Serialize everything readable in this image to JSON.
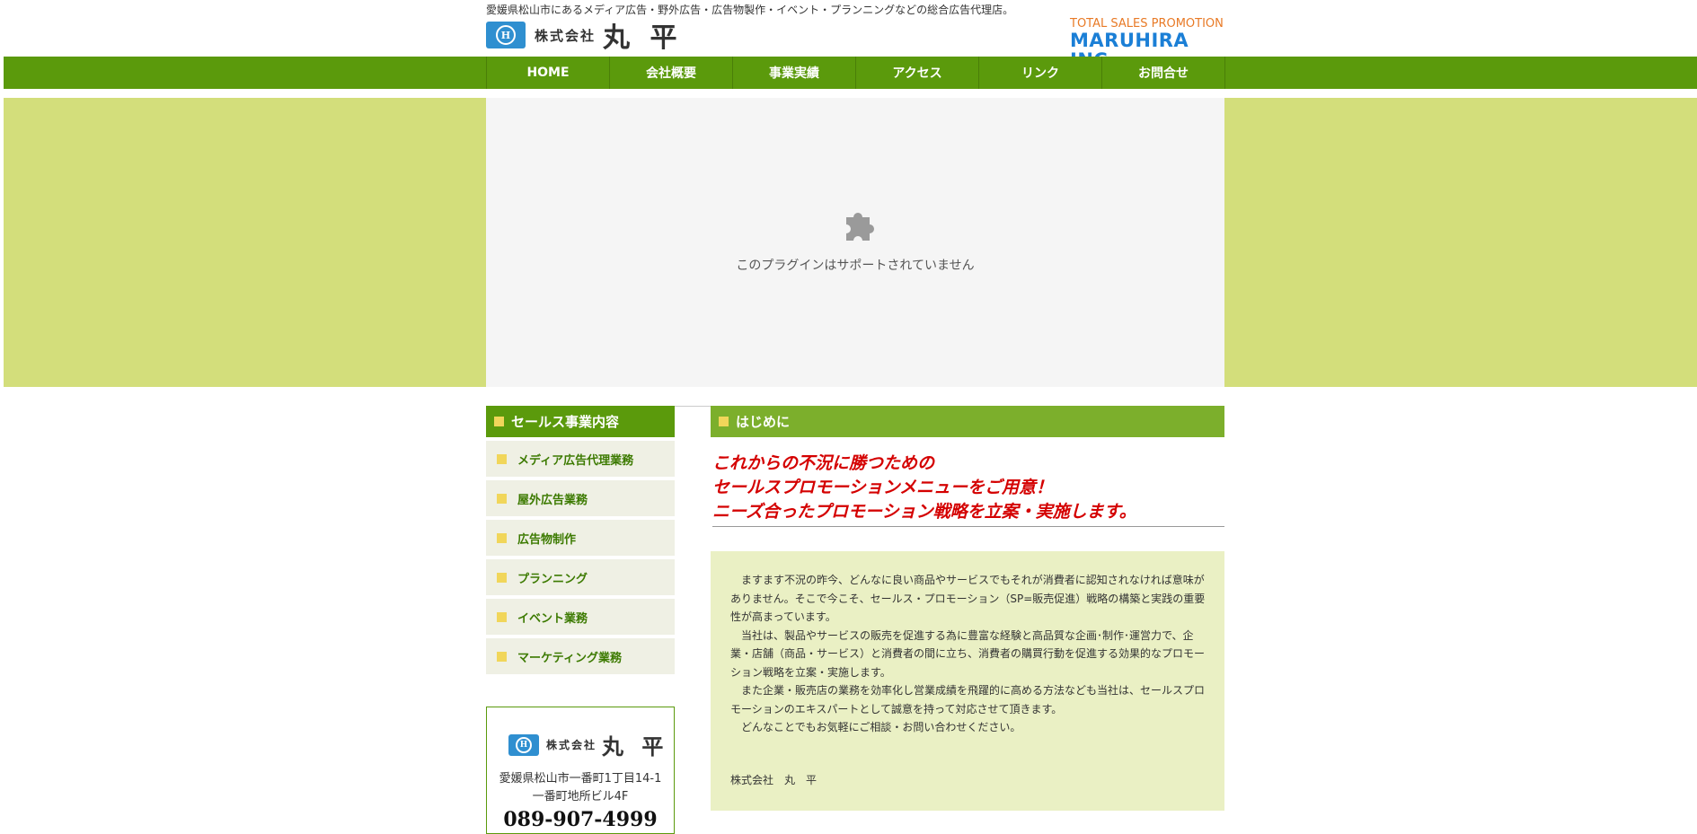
{
  "header": {
    "tagline": "愛媛県松山市にあるメディア広告・野外広告・広告物製作・イベント・プランニングなどの総合広告代理店。",
    "logo_kabushiki": "株式会社",
    "logo_name": "丸 平",
    "logo_mark": "H",
    "brand_sub": "TOTAL SALES PROMOTION",
    "brand_main": "MARUHIRA INC."
  },
  "nav": {
    "items": [
      {
        "label": "HOME"
      },
      {
        "label": "会社概要"
      },
      {
        "label": "事業実績"
      },
      {
        "label": "アクセス"
      },
      {
        "label": "リンク"
      },
      {
        "label": "お問合せ"
      }
    ]
  },
  "plugin": {
    "message": "このプラグインはサポートされていません",
    "icon": "puzzle-piece-icon"
  },
  "sidebar": {
    "heading": "セールス事業内容",
    "items": [
      {
        "label": "メディア広告代理業務"
      },
      {
        "label": "屋外広告業務"
      },
      {
        "label": "広告物制作"
      },
      {
        "label": "プランニング"
      },
      {
        "label": "イベント業務"
      },
      {
        "label": "マーケティング業務"
      }
    ],
    "address": {
      "line1": "愛媛県松山市一番町1丁目14-1",
      "line2": "一番町地所ビル4F",
      "tel": "089-907-4999"
    }
  },
  "main": {
    "heading": "はじめに",
    "catch_lines": [
      "これからの不況に勝つための",
      "セールスプロモーションメニューをご用意！",
      "ニーズ合ったプロモーション戦略を立案・実施します。"
    ],
    "paragraphs": [
      "ますます不況の昨今、どんなに良い商品やサービスでもそれが消費者に認知されなければ意味がありません。そこで今こそ、セールス・プロモーション（SP=販売促進）戦略の構築と実践の重要性が高まっています。",
      "当社は、製品やサービスの販売を促進する為に豊富な経験と高品質な企画･制作･運営力で、企業・店舗（商品・サービス）と消費者の間に立ち、消費者の購買行動を促進する効果的なプロモーション戦略を立案・実施します。",
      "また企業・販売店の業務を効率化し営業成績を飛躍的に高める方法なども当社は、セールスプロモーションのエキスパートとして誠意を持って対応させて頂きます。",
      "どんなことでもお気軽にご相談・お問い合わせください。"
    ],
    "signature": "株式会社　丸　平"
  },
  "colors": {
    "nav_green": "#5b9a0c",
    "hero_green": "#d3de7b",
    "heading_green": "#7caf2c",
    "catch_red": "#d40000",
    "brand_blue": "#1b7fd6",
    "brand_orange": "#e87a26",
    "bullet_yellow": "#f1d65a"
  }
}
